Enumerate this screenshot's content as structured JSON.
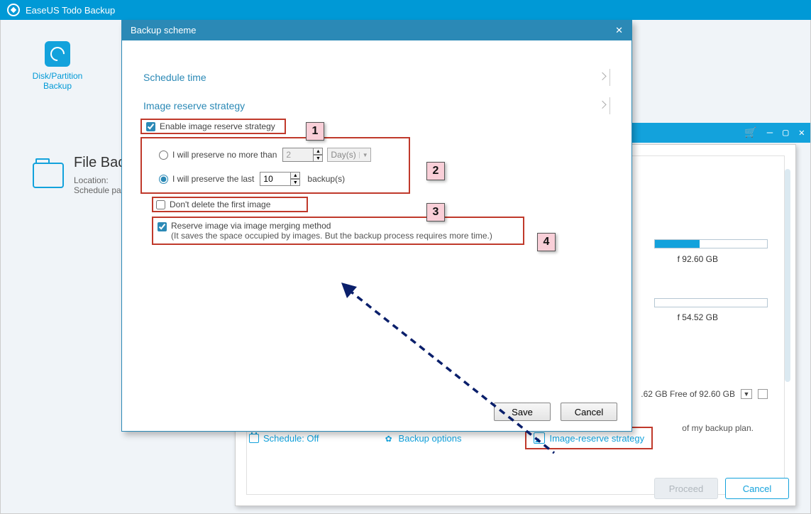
{
  "titlebar": {
    "app_name": "EaseUS Todo Backup"
  },
  "sidebar": {
    "label": "Disk/Partition\nBackup"
  },
  "file_card": {
    "title": "File Back",
    "loc_label": "Location: ",
    "sched_label": "Schedule pa"
  },
  "inner_win": {
    "cart": "🛒",
    "min": "—",
    "max": "▢",
    "close": "✕"
  },
  "capacity": {
    "c1": "f 92.60 GB",
    "c2": "f 54.52 GB",
    "free": ".62 GB Free of 92.60 GB",
    "desc": "of my backup plan."
  },
  "modal": {
    "title": "Backup scheme",
    "section1": "Schedule time",
    "section2": "Image reserve strategy",
    "enable": "Enable image reserve strategy",
    "r1_label": "I will preserve no more than",
    "r1_value": "2",
    "r1_unit": "Day(s)",
    "r2_label": "I will preserve the last",
    "r2_value": "10",
    "r2_suffix": "backup(s)",
    "c1": "Don't delete the first image",
    "c2_line1": "Reserve image via image merging method",
    "c2_line2": "(It saves the space occupied by images. But the backup process requires more time.)",
    "save": "Save",
    "cancel": "Cancel"
  },
  "callouts": {
    "n1": "1",
    "n2": "2",
    "n3": "3",
    "n4": "4"
  },
  "links": {
    "schedule": "Schedule: Off",
    "options": "Backup options",
    "strategy": "Image-reserve strategy"
  },
  "bottom": {
    "proceed": "Proceed",
    "cancel": "Cancel"
  }
}
